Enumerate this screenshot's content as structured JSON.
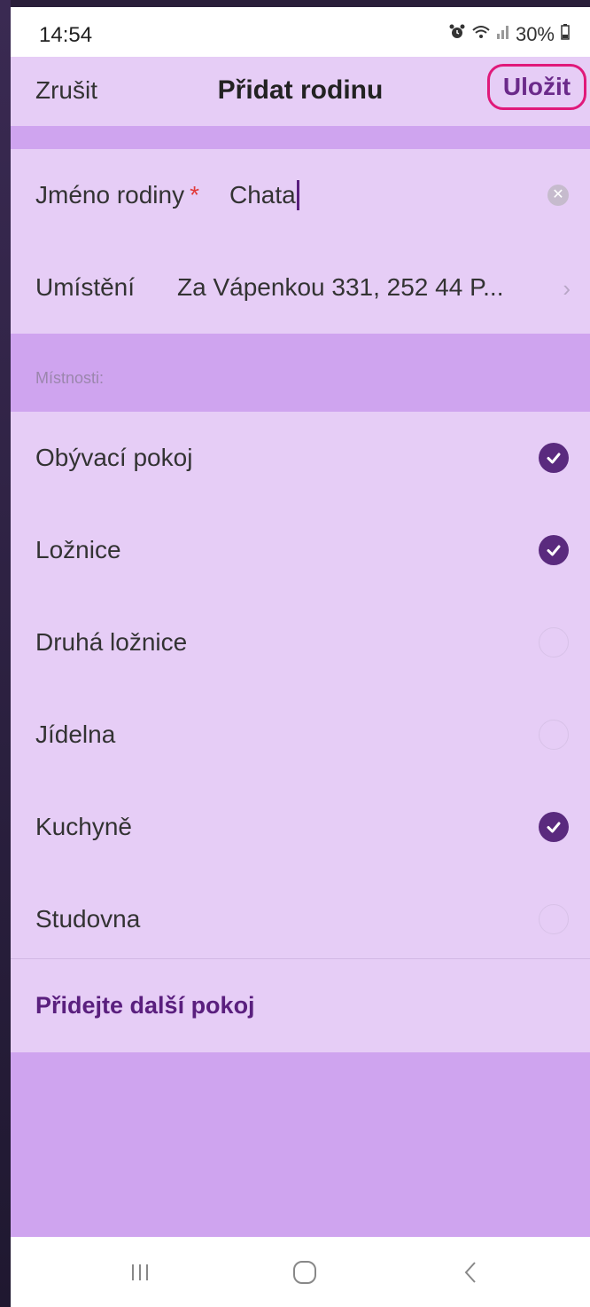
{
  "status": {
    "time": "14:54",
    "battery": "30%"
  },
  "header": {
    "cancel": "Zrušit",
    "title": "Přidat rodinu",
    "save": "Uložit"
  },
  "form": {
    "family_name_label": "Jméno rodiny",
    "required_marker": "*",
    "family_name_value": "Chata",
    "location_label": "Umístění",
    "location_value": "Za Vápenkou 331, 252 44 P..."
  },
  "rooms": {
    "header": "Místnosti:",
    "items": [
      {
        "label": "Obývací pokoj",
        "checked": true
      },
      {
        "label": "Ložnice",
        "checked": true
      },
      {
        "label": "Druhá ložnice",
        "checked": false
      },
      {
        "label": "Jídelna",
        "checked": false
      },
      {
        "label": "Kuchyně",
        "checked": true
      },
      {
        "label": "Studovna",
        "checked": false
      }
    ],
    "add_room": "Přidejte další pokoj"
  },
  "colors": {
    "accent": "#5a2a7e",
    "background": "#e6cdf6",
    "band": "#cfa4ef",
    "highlight": "#e0197a"
  }
}
